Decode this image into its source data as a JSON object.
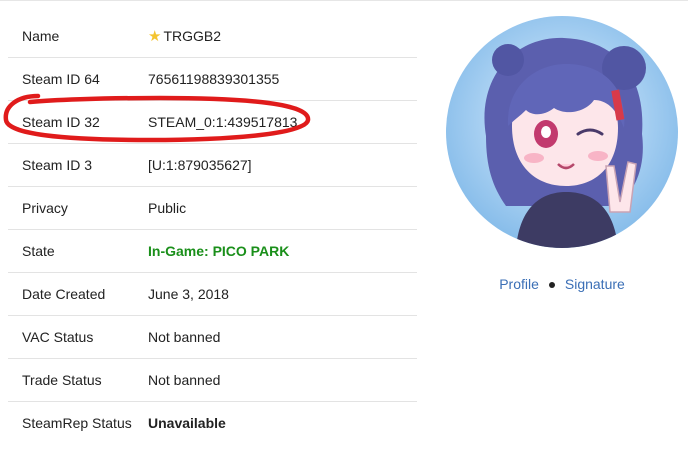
{
  "rows": [
    {
      "label": "Name",
      "value": "TRGGB2",
      "style": "name"
    },
    {
      "label": "Steam ID 64",
      "value": "76561198839301355",
      "style": "normal"
    },
    {
      "label": "Steam ID 32",
      "value": "STEAM_0:1:439517813",
      "style": "normal"
    },
    {
      "label": "Steam ID 3",
      "value": "[U:1:879035627]",
      "style": "normal"
    },
    {
      "label": "Privacy",
      "value": "Public",
      "style": "normal"
    },
    {
      "label": "State",
      "value": "In-Game: PICO PARK",
      "style": "green"
    },
    {
      "label": "Date Created",
      "value": "June 3, 2018",
      "style": "normal"
    },
    {
      "label": "VAC Status",
      "value": "Not banned",
      "style": "normal"
    },
    {
      "label": "Trade Status",
      "value": "Not banned",
      "style": "normal"
    },
    {
      "label": "SteamRep Status",
      "value": "Unavailable",
      "style": "bold"
    }
  ],
  "links": {
    "profile": "Profile",
    "signature": "Signature"
  },
  "icons": {
    "name_badge": "star-icon"
  },
  "colors": {
    "link": "#3b6fb6",
    "ingame": "#1a8f1a",
    "annotation": "#e01b1b"
  }
}
